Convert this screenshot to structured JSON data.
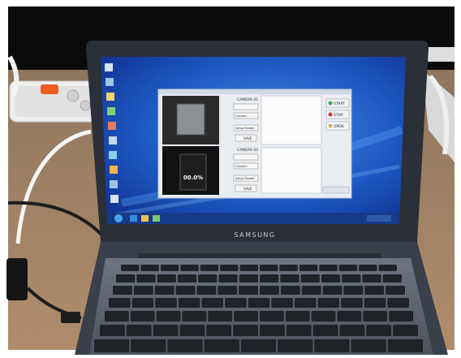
{
  "laptop": {
    "brand": "SAMSUNG"
  },
  "app_window": {
    "panels": [
      {
        "header": "CAMERA 01",
        "buttons": [
          "Connect",
          "Setup Reader",
          "SAVE"
        ],
        "readout": "00.0%"
      },
      {
        "header": "CAMERA 02",
        "buttons": [
          "Connect",
          "Setup Reader",
          "SAVE"
        ]
      }
    ],
    "side_buttons": [
      "START",
      "STOP",
      "OPEN"
    ]
  },
  "colors": {
    "desktop_blue": "#1a4fb5",
    "window_face": "#e9edf2",
    "keyboard": "#5d6570",
    "table_wood": "#a9876a",
    "power_strip_light": "#f05a1e"
  }
}
